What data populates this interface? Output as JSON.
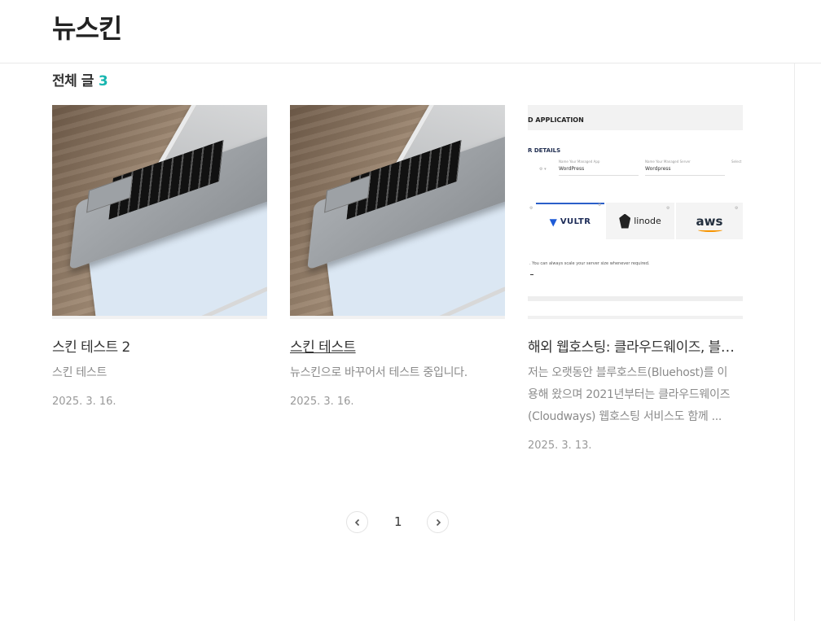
{
  "site": {
    "logo": "뉴스킨"
  },
  "section": {
    "title": "전체 글",
    "count": "3"
  },
  "posts": [
    {
      "title": "스킨 테스트 2",
      "excerpt": "스킨 테스트",
      "date": "2025. 3. 16."
    },
    {
      "title": "스킨 테스트",
      "excerpt": "뉴스킨으로 바꾸어서 테스트 중입니다.",
      "date": "2025. 3. 16."
    },
    {
      "title": "해외 웹호스팅: 클라우드웨이즈, 블루호스트",
      "excerpt_lines": [
        "저는 오랫동안 블루호스트(Bluehost)를 이",
        "용해 왔으며 2021년부터는 클라우드웨이즈",
        "(Cloudways) 웹호스팅 서비스도 함께 ..."
      ],
      "date": "2025. 3. 13."
    }
  ],
  "thumb3": {
    "header": "D APPLICATION",
    "details": "R DETAILS",
    "app_label": "Name Your Managed App",
    "app_value": "WordPress",
    "server_label": "Name Your Managed Server",
    "server_value": "Wordpress",
    "select_label": "Select",
    "providers": [
      "VULTR",
      "linode",
      "aws"
    ],
    "note": ". You can always scale your server size whenever required."
  },
  "pagination": {
    "current": "1",
    "prev_icon": "chevron-left-icon",
    "next_icon": "chevron-right-icon"
  },
  "colors": {
    "accent": "#18b6b0"
  }
}
